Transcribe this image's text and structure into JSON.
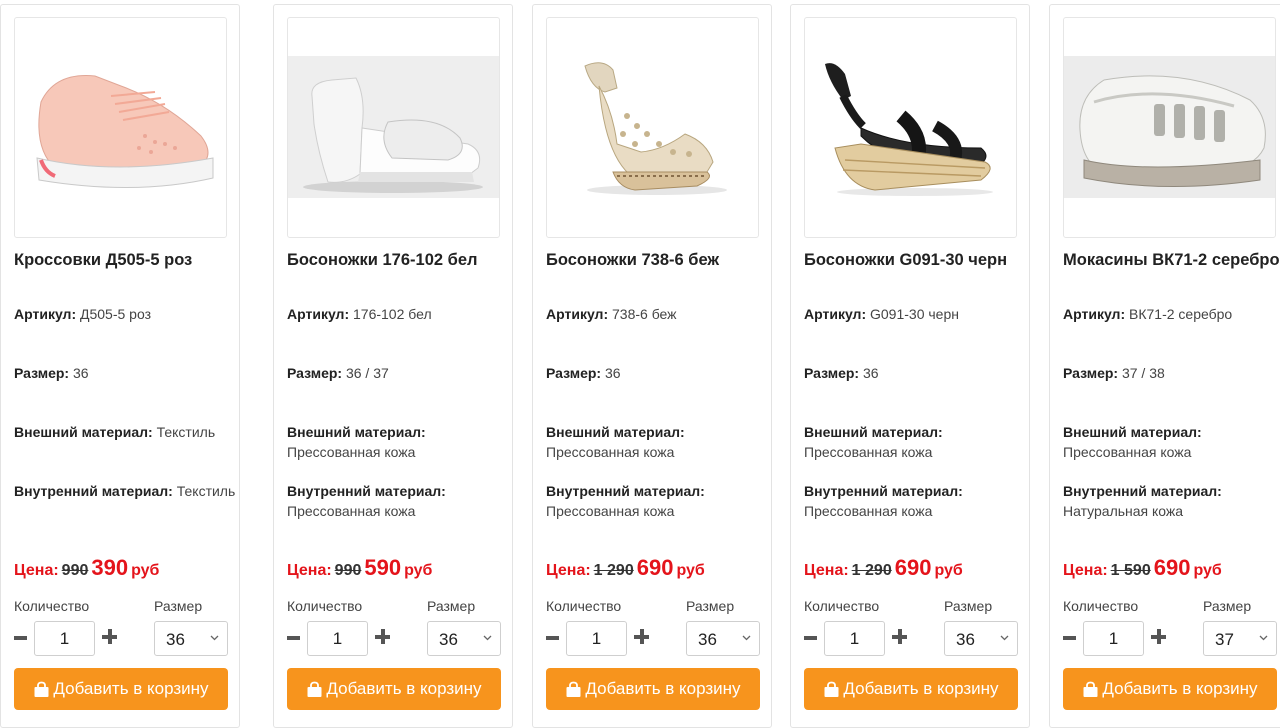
{
  "labels": {
    "article": "Артикул:",
    "size": "Размер:",
    "outer_material": "Внешний материал:",
    "inner_material": "Внутренний материал:",
    "price": "Цена:",
    "currency": "руб",
    "quantity": "Количество",
    "size_select": "Размер",
    "add_to_cart": "Добавить в корзину"
  },
  "colors": {
    "accent_button": "#f7941d",
    "price_red": "#e4141b"
  },
  "products": [
    {
      "name": "Босоножки 176-102 бел",
      "article": "176-102 бел",
      "size": "36 / 37",
      "outer_material": "Прессованная кожа",
      "inner_material": "Прессованная кожа",
      "old_price": "990",
      "new_price": "590",
      "quantity": "1",
      "selected_size": "36",
      "image": "white-wedge-mule-sandal"
    },
    {
      "name": "Босоножки 738-6 беж",
      "article": "738-6 беж",
      "size": "36",
      "outer_material": "Прессованная кожа",
      "inner_material": "Прессованная кожа",
      "old_price": "1 290",
      "new_price": "690",
      "quantity": "1",
      "selected_size": "36",
      "image": "beige-perforated-wedge-sandal"
    },
    {
      "name": "Босоножки G091-30 черн",
      "article": "G091-30 черн",
      "size": "36",
      "outer_material": "Прессованная кожа",
      "inner_material": "Прессованная кожа",
      "old_price": "1 290",
      "new_price": "690",
      "quantity": "1",
      "selected_size": "36",
      "image": "black-espadrille-wedge-sandal"
    },
    {
      "name": "Мокасины ВК71-2 серебро",
      "article": "ВК71-2 серебро",
      "size": "37 / 38",
      "outer_material": "Прессованная кожа",
      "inner_material": "Натуральная кожа",
      "old_price": "1 590",
      "new_price": "690",
      "quantity": "1",
      "selected_size": "37",
      "image": "silver-fisherman-moccasin"
    },
    {
      "name": "Кроссовки Д505-5 роз",
      "article": "Д505-5 роз",
      "size": "36",
      "outer_material": "Текстиль",
      "inner_material": "Текстиль",
      "old_price": "990",
      "new_price": "390",
      "quantity": "1",
      "selected_size": "36",
      "image": "pink-knit-sneaker"
    }
  ]
}
